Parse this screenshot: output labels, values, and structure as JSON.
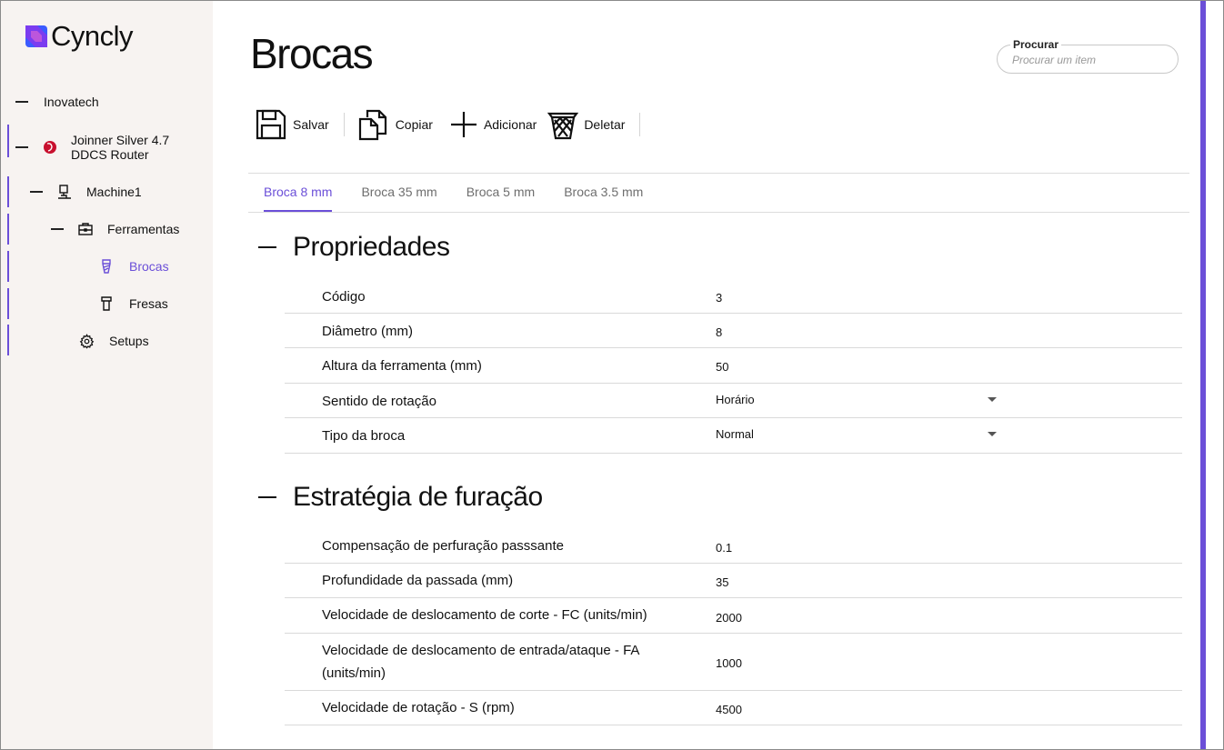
{
  "app": {
    "logo_text": "Cyncly"
  },
  "sidebar": {
    "items": [
      {
        "label": "Inovatech"
      },
      {
        "label": "Joinner Silver 4.7\nDDCS Router"
      },
      {
        "label": "Machine1"
      },
      {
        "label": "Ferramentas"
      },
      {
        "label": "Brocas"
      },
      {
        "label": "Fresas"
      },
      {
        "label": "Setups"
      }
    ]
  },
  "page": {
    "title": "Brocas"
  },
  "search": {
    "label": "Procurar",
    "placeholder": "Procurar um item"
  },
  "toolbar": {
    "save_label": "Salvar",
    "copy_label": "Copiar",
    "add_label": "Adicionar",
    "delete_label": "Deletar"
  },
  "tabs": [
    {
      "label": "Broca 8 mm",
      "active": true
    },
    {
      "label": "Broca 35 mm"
    },
    {
      "label": "Broca 5 mm"
    },
    {
      "label": "Broca 3.5 mm"
    }
  ],
  "sections": {
    "properties": {
      "title": "Propriedades",
      "rows": [
        {
          "label": "Código",
          "value": "3"
        },
        {
          "label": "Diâmetro (mm)",
          "value": "8"
        },
        {
          "label": "Altura da ferramenta (mm)",
          "value": "50"
        },
        {
          "label": "Sentido de rotação",
          "value": "Horário"
        },
        {
          "label": "Tipo da broca",
          "value": "Normal"
        }
      ]
    },
    "strategy": {
      "title": "Estratégia de furação",
      "rows": [
        {
          "label": "Compensação de perfuração passsante",
          "value": "0.1"
        },
        {
          "label": "Profundidade da passada (mm)",
          "value": "35"
        },
        {
          "label": "Velocidade de deslocamento de corte - FC (units/min)",
          "value": "2000"
        },
        {
          "label": "Velocidade de deslocamento de entrada/ataque - FA (units/min)",
          "value": "1000"
        },
        {
          "label": "Velocidade de rotação - S (rpm)",
          "value": "4500"
        }
      ]
    }
  },
  "colors": {
    "accent": "#6b4fd8",
    "sidebar_bg": "#f7f3f1"
  }
}
